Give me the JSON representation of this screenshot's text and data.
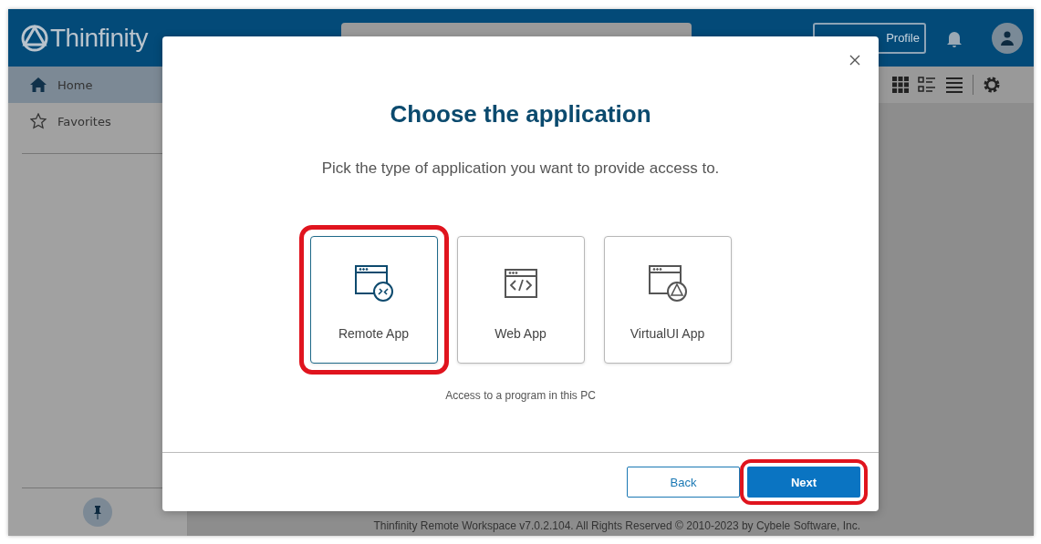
{
  "header": {
    "brand": "Thinfinity",
    "new_profile_label": "Profile"
  },
  "sidebar": {
    "items": [
      {
        "label": "Home",
        "kind": "home",
        "selected": true
      },
      {
        "label": "Favorites",
        "kind": "star",
        "selected": false
      }
    ]
  },
  "dialog": {
    "title": "Choose the application",
    "subtitle": "Pick the type of application you want to provide access to.",
    "options": [
      {
        "label": "Remote App",
        "kind": "remote",
        "selected": true,
        "highlighted": true
      },
      {
        "label": "Web App",
        "kind": "web",
        "selected": false,
        "highlighted": false
      },
      {
        "label": "VirtualUI App",
        "kind": "virtualui",
        "selected": false,
        "highlighted": false
      }
    ],
    "hint": "Access to a program in this PC",
    "buttons": [
      {
        "label": "Back",
        "kind": "secondary",
        "highlighted": false
      },
      {
        "label": "Next",
        "kind": "primary",
        "highlighted": true
      }
    ]
  },
  "footer": "Thinfinity Remote Workspace v7.0.2.104. All Rights Reserved © 2010-2023 by Cybele Software, Inc."
}
